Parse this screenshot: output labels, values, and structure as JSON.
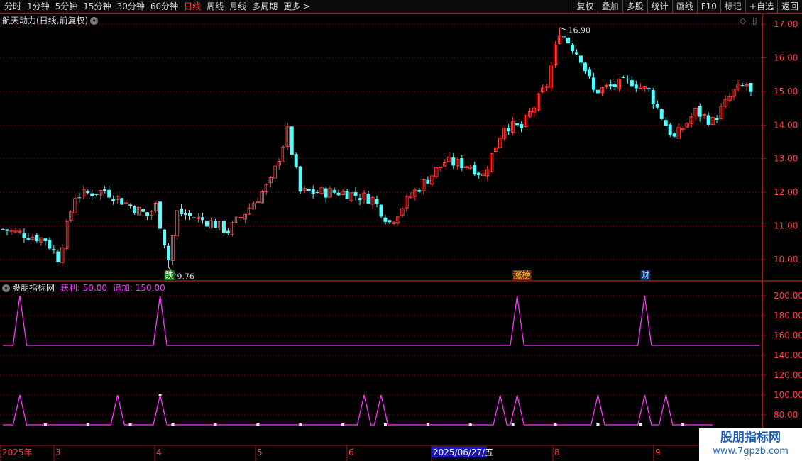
{
  "toolbar": {
    "periods": [
      "分时",
      "1分钟",
      "5分钟",
      "15分钟",
      "30分钟",
      "60分钟",
      "日线",
      "周线",
      "月线",
      "多周期",
      "更多 >"
    ],
    "active_period": "日线",
    "actions": [
      "复权",
      "叠加",
      "多股",
      "统计",
      "画线",
      "F10",
      "标记",
      "+自选",
      "返回"
    ]
  },
  "header": {
    "title": "航天动力(日线,前复权)",
    "chevron_icon": "chevron-down-icon",
    "diamond_icon": "diamond-icon",
    "pin_icon": "page-icon"
  },
  "indicator": {
    "name": "股朋指标网",
    "label1": "获利: 50.00",
    "label2": "追加: 150.00"
  },
  "date_axis": {
    "labels": [
      "2025年",
      "3",
      "4",
      "5",
      "6",
      "2025/06/27/五",
      "8",
      "9"
    ],
    "cursor": "2025/06/27/五"
  },
  "watermark": {
    "line1": "股朋指标网",
    "line2": "www.7gpzb.com"
  },
  "colors": {
    "up": "#ff3c3c",
    "down": "#54ffff",
    "axis": "#a01818",
    "grid": "#7a1010",
    "indicator": "#ff33ff",
    "text": "#cccccc",
    "accent": "#ff4040"
  },
  "chart_data": [
    {
      "type": "candlestick",
      "title": "航天动力(日线,前复权)",
      "ylim": [
        9.7,
        17.2
      ],
      "yticks": [
        "10.00",
        "11.00",
        "12.00",
        "13.00",
        "14.00",
        "15.00",
        "16.00",
        "17.00"
      ],
      "annotations": {
        "high": "16.90",
        "low": "9.76",
        "tags": [
          "跌",
          "涨榜",
          "财"
        ]
      },
      "anchors": [
        [
          0,
          10.9
        ],
        [
          10,
          10.6
        ],
        [
          13,
          10.05
        ],
        [
          17,
          11.9
        ],
        [
          24,
          12.05
        ],
        [
          34,
          11.3
        ],
        [
          36,
          11.6
        ],
        [
          39,
          10.0
        ],
        [
          41,
          11.4
        ],
        [
          49,
          11.1
        ],
        [
          53,
          10.85
        ],
        [
          57,
          11.4
        ],
        [
          63,
          12.3
        ],
        [
          67,
          13.8
        ],
        [
          70,
          12.0
        ],
        [
          80,
          12.0
        ],
        [
          87,
          11.8
        ],
        [
          91,
          11.1
        ],
        [
          96,
          11.9
        ],
        [
          104,
          12.9
        ],
        [
          110,
          12.8
        ],
        [
          113,
          12.5
        ],
        [
          118,
          14.0
        ],
        [
          122,
          13.9
        ],
        [
          128,
          15.2
        ],
        [
          131,
          16.8
        ],
        [
          136,
          16.0
        ],
        [
          139,
          15.0
        ],
        [
          148,
          15.3
        ],
        [
          152,
          15.0
        ],
        [
          156,
          14.0
        ],
        [
          158,
          13.6
        ],
        [
          163,
          14.4
        ],
        [
          167,
          14.1
        ],
        [
          172,
          15.0
        ],
        [
          175,
          15.2
        ],
        [
          176,
          14.9
        ]
      ],
      "count": 177
    },
    {
      "type": "line",
      "name": "股朋指标网",
      "ylim": [
        70,
        210
      ],
      "yticks": [
        "80.00",
        "100.00",
        "120.00",
        "140.00",
        "160.00",
        "180.00",
        "200.00"
      ],
      "series": [
        {
          "name": "upper",
          "baseline": 150,
          "peak": 200,
          "spikes": [
            4,
            37,
            121,
            151
          ],
          "end": 178
        },
        {
          "name": "lower",
          "baseline": 70,
          "peak": 100,
          "spikes": [
            4,
            27,
            37,
            85,
            89,
            117,
            121,
            140,
            151,
            156
          ],
          "end": 167
        }
      ]
    }
  ]
}
